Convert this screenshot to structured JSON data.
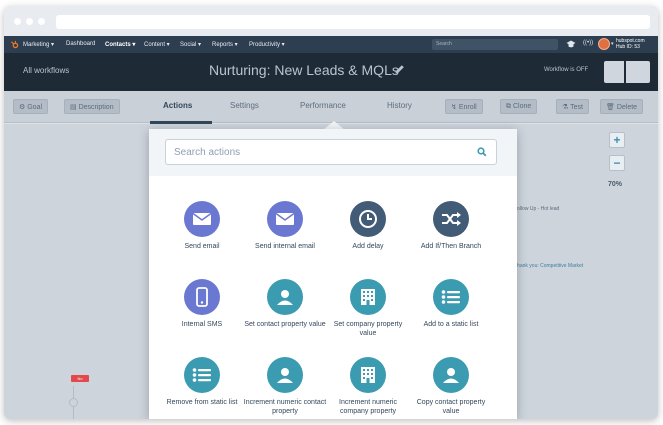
{
  "nav": {
    "items": [
      "Marketing",
      "Dashboard",
      "Contacts",
      "Content",
      "Social",
      "Reports",
      "Productivity"
    ],
    "search_placeholder": "Search",
    "hub_domain": "hubspot.com",
    "hub_id": "Hub ID: 53"
  },
  "workflow": {
    "back_label": "All workflows",
    "title": "Nurturing: New Leads & MQLs",
    "status": "Workflow is OFF"
  },
  "toolbar": {
    "goal_label": "Goal",
    "description_label": "Description",
    "tabs": [
      "Actions",
      "Settings",
      "Performance",
      "History"
    ],
    "active_tab": "Actions",
    "enroll_label": "Enroll",
    "clone_label": "Clone",
    "test_label": "Test",
    "delete_label": "Delete"
  },
  "canvas": {
    "zoom_in": "+",
    "zoom_out": "−",
    "zoom_level": "70%",
    "bg_text_1": "Follow Up - Hot lead",
    "bg_text_2": "Thank you: Competitive Market",
    "tag_label": "No"
  },
  "actions_panel": {
    "search_placeholder": "Search actions",
    "items": [
      {
        "label": "Send email",
        "icon": "envelope-icon",
        "color": "#6a78d1"
      },
      {
        "label": "Send internal email",
        "icon": "envelope-icon",
        "color": "#6a78d1"
      },
      {
        "label": "Add delay",
        "icon": "clock-icon",
        "color": "#425b76"
      },
      {
        "label": "Add If/Then Branch",
        "icon": "shuffle-icon",
        "color": "#425b76"
      },
      {
        "label": "Internal SMS",
        "icon": "phone-icon",
        "color": "#6a78d1"
      },
      {
        "label": "Set contact property value",
        "icon": "person-icon",
        "color": "#3a9bb1"
      },
      {
        "label": "Set company property value",
        "icon": "building-icon",
        "color": "#3a9bb1"
      },
      {
        "label": "Add to a static list",
        "icon": "list-icon",
        "color": "#3a9bb1"
      },
      {
        "label": "Remove from static list",
        "icon": "list-icon",
        "color": "#3a9bb1"
      },
      {
        "label": "Increment numeric contact property",
        "icon": "person-icon",
        "color": "#3a9bb1"
      },
      {
        "label": "Increment numeric company property",
        "icon": "building-icon",
        "color": "#3a9bb1"
      },
      {
        "label": "Copy contact property value",
        "icon": "person-icon",
        "color": "#3a9bb1"
      }
    ]
  },
  "colors": {
    "nav_bg": "#2d3e50",
    "header_bg": "#1e2a35",
    "accent_teal": "#3a9bb1",
    "accent_purple": "#6a78d1",
    "accent_slate": "#425b76"
  }
}
